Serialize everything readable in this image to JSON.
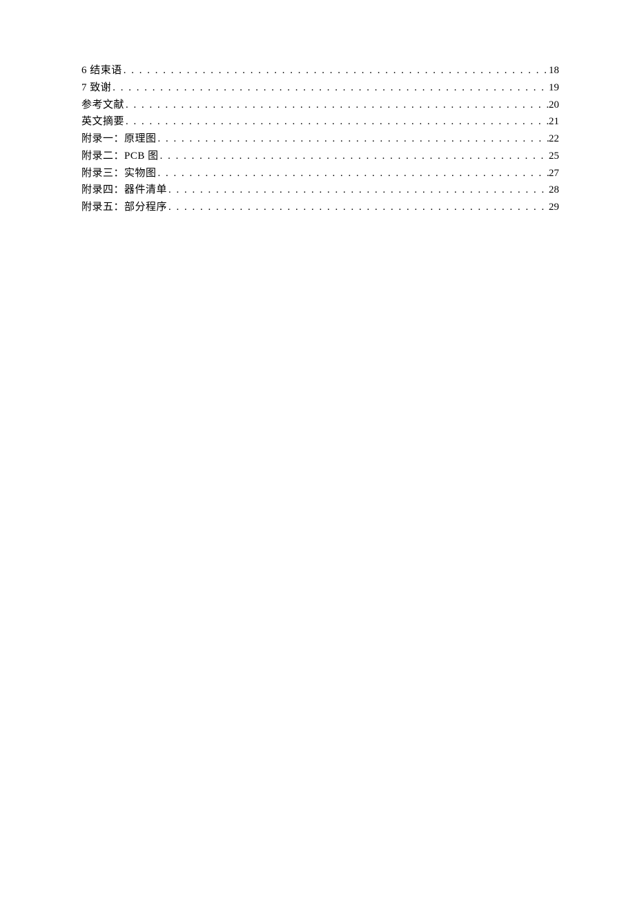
{
  "toc": {
    "entries": [
      {
        "label": "6 结束语",
        "page": "18"
      },
      {
        "label": "7 致谢",
        "page": "19"
      },
      {
        "label": "参考文献",
        "page": "20"
      },
      {
        "label": "英文摘要",
        "page": "21"
      },
      {
        "label": "附录一：原理图",
        "page": "22"
      },
      {
        "label": "附录二：PCB 图",
        "page": "25"
      },
      {
        "label": "附录三：实物图",
        "page": "27"
      },
      {
        "label": "附录四：器件清单",
        "page": "28"
      },
      {
        "label": "附录五：部分程序",
        "page": "29"
      }
    ]
  }
}
